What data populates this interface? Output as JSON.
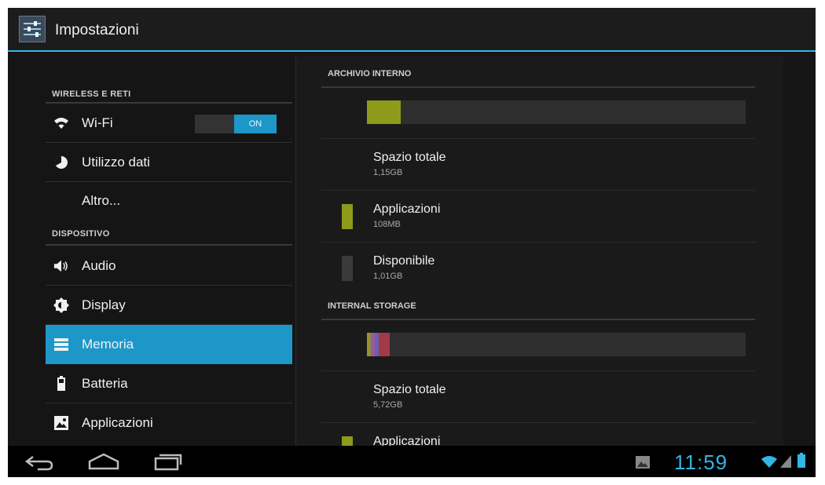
{
  "app": {
    "title": "Impostazioni",
    "icon": "settings-sliders-icon"
  },
  "colors": {
    "accent": "#33b5e5",
    "selection": "#1d97c8",
    "apps_bar": "#8d9a1a",
    "free_bar": "#3a3a3a"
  },
  "sidebar": {
    "sections": [
      {
        "header": "WIRELESS E RETI",
        "items": [
          {
            "label": "Wi-Fi",
            "icon": "wifi-icon",
            "toggle": "ON"
          },
          {
            "label": "Utilizzo dati",
            "icon": "data-usage-icon"
          },
          {
            "label": "Altro...",
            "icon": ""
          }
        ]
      },
      {
        "header": "DISPOSITIVO",
        "items": [
          {
            "label": "Audio",
            "icon": "speaker-icon"
          },
          {
            "label": "Display",
            "icon": "brightness-icon"
          },
          {
            "label": "Memoria",
            "icon": "storage-icon",
            "selected": true
          },
          {
            "label": "Batteria",
            "icon": "battery-icon"
          },
          {
            "label": "Applicazioni",
            "icon": "apps-icon"
          }
        ]
      }
    ]
  },
  "storage": [
    {
      "header": "ARCHIVIO INTERNO",
      "usage_fraction": 0.09,
      "total": {
        "label": "Spazio totale",
        "value": "1,15GB"
      },
      "rows": [
        {
          "label": "Applicazioni",
          "value": "108MB"
        },
        {
          "label": "Disponibile",
          "value": "1,01GB"
        }
      ]
    },
    {
      "header": "INTERNAL STORAGE",
      "usage_fraction": 0.06,
      "total": {
        "label": "Spazio totale",
        "value": "5,72GB"
      },
      "rows": [
        {
          "label": "Applicazioni",
          "value": ""
        }
      ]
    }
  ],
  "statusbar": {
    "time": "11:59"
  },
  "navbar": {
    "back": "back-icon",
    "home": "home-icon",
    "recents": "recents-icon"
  }
}
